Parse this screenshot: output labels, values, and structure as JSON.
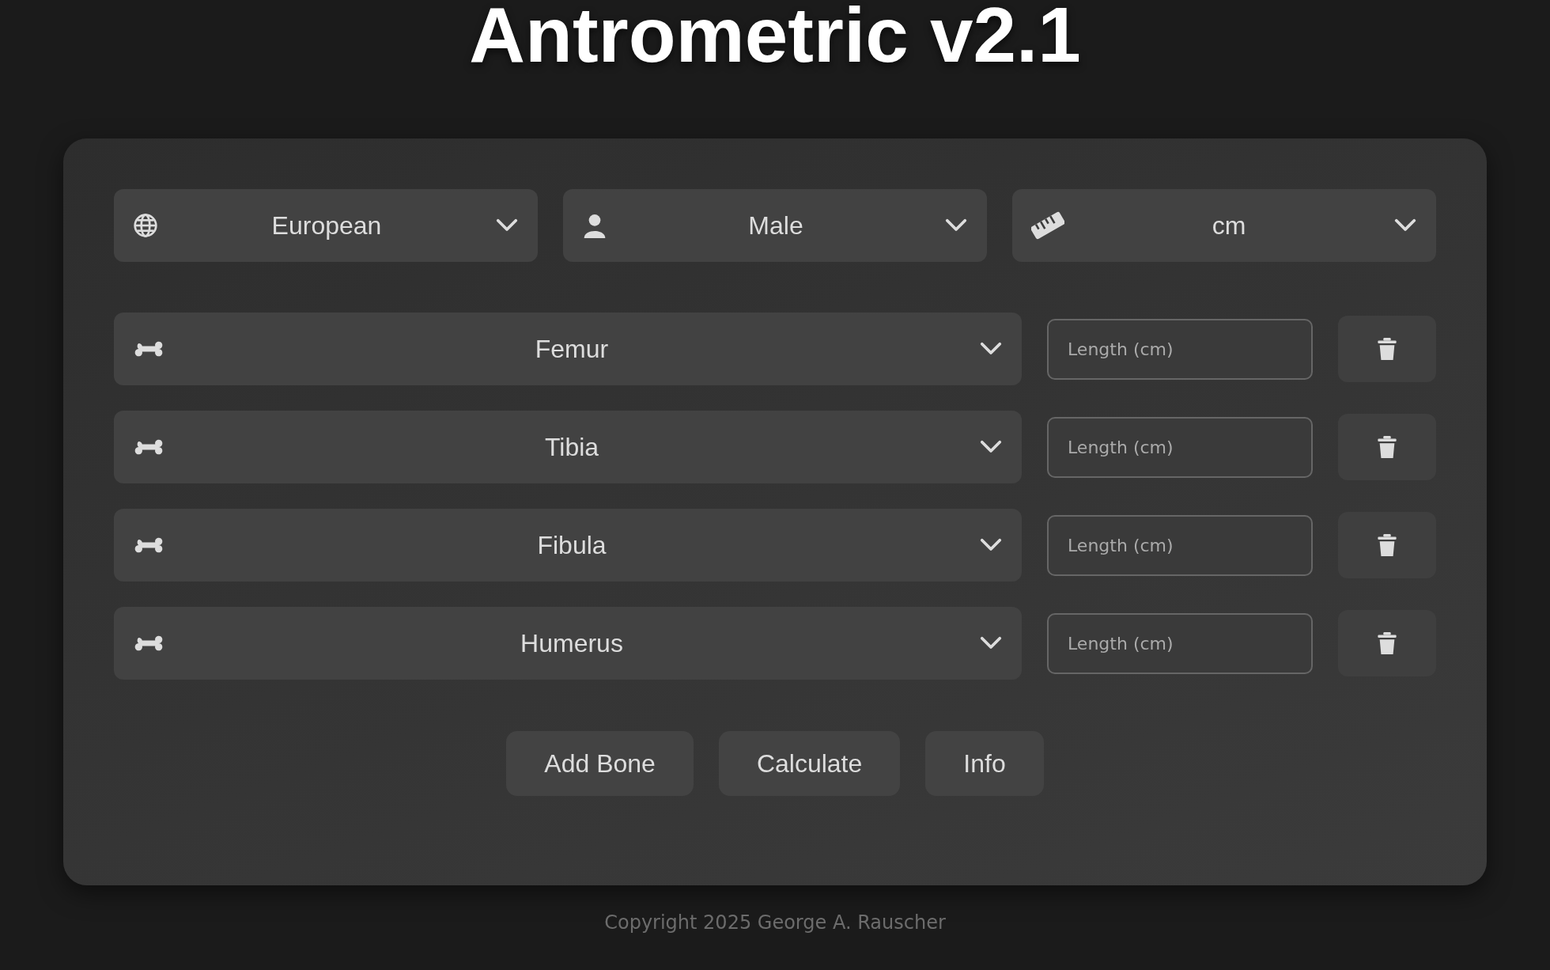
{
  "title": "Antrometric v2.1",
  "selectors": [
    {
      "value": "European"
    },
    {
      "value": "Male"
    },
    {
      "value": "cm"
    }
  ],
  "bones": [
    {
      "name": "Femur",
      "placeholder": "Length (cm)"
    },
    {
      "name": "Tibia",
      "placeholder": "Length (cm)"
    },
    {
      "name": "Fibula",
      "placeholder": "Length (cm)"
    },
    {
      "name": "Humerus",
      "placeholder": "Length (cm)"
    }
  ],
  "buttons": [
    "Add Bone",
    "Calculate",
    "Info"
  ],
  "footer": "Copyright 2025 George A. Rauscher"
}
